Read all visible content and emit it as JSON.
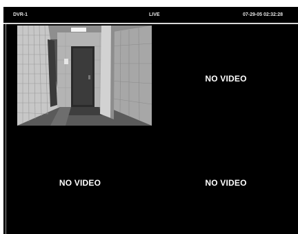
{
  "header": {
    "device_name": "DVR-1",
    "mode": "LIVE",
    "datetime": "07-29-05 02:32:28"
  },
  "channels": [
    {
      "state": "live_video"
    },
    {
      "state": "no_video",
      "label": "NO VIDEO"
    },
    {
      "state": "no_video",
      "label": "NO VIDEO"
    },
    {
      "state": "no_video",
      "label": "NO VIDEO"
    }
  ]
}
